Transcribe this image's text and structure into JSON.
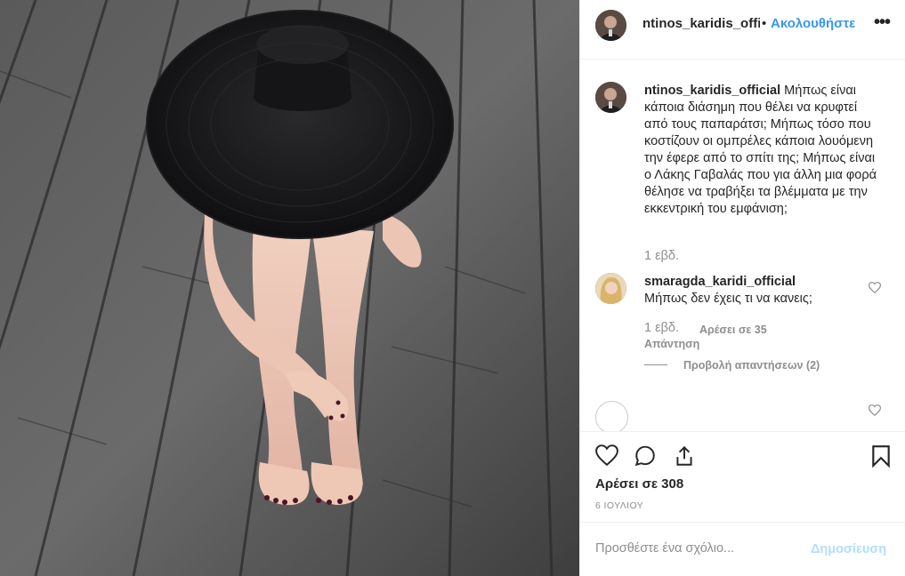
{
  "header": {
    "username": "ntinos_karidis_official",
    "separator": "•",
    "follow_label": "Ακολουθήστε",
    "more_icon": "more-options-icon"
  },
  "caption": {
    "username": "ntinos_karidis_official",
    "text": "Μήπως είναι κάποια διάσημη που θέλει να κρυφτεί από τους παπαράτσι; Μήπως τόσο που κοστίζουν οι ομπρέλες κάποια λουόμενη την έφερε από το σπίτι της; Μήπως είναι ο Λάκης Γαβαλάς που για άλλη μια φορά θέλησε να τραβήξει τα βλέμματα με την εκκεντρική του εμφάνιση;",
    "time": "1 εβδ."
  },
  "comment": {
    "username": "smaragda_karidi_official",
    "text": "Μήπως δεν έχεις τι να κανεις;",
    "time": "1 εβδ.",
    "likes": "Αρέσει σε 35",
    "reply_label": "Απάντηση",
    "view_replies": "Προβολή απαντήσεων (2)"
  },
  "actions": {
    "likes_count": "Αρέσει σε 308",
    "date": "6 ΙΟΥΛΙΟΥ"
  },
  "add_comment": {
    "placeholder": "Προσθέστε ένα σχόλιο...",
    "post_label": "Δημοσίευση"
  },
  "colors": {
    "accent": "#3897f0",
    "post_disabled": "#b2dffc",
    "muted": "#8e8e8e",
    "text": "#262626",
    "border": "#efefef"
  }
}
